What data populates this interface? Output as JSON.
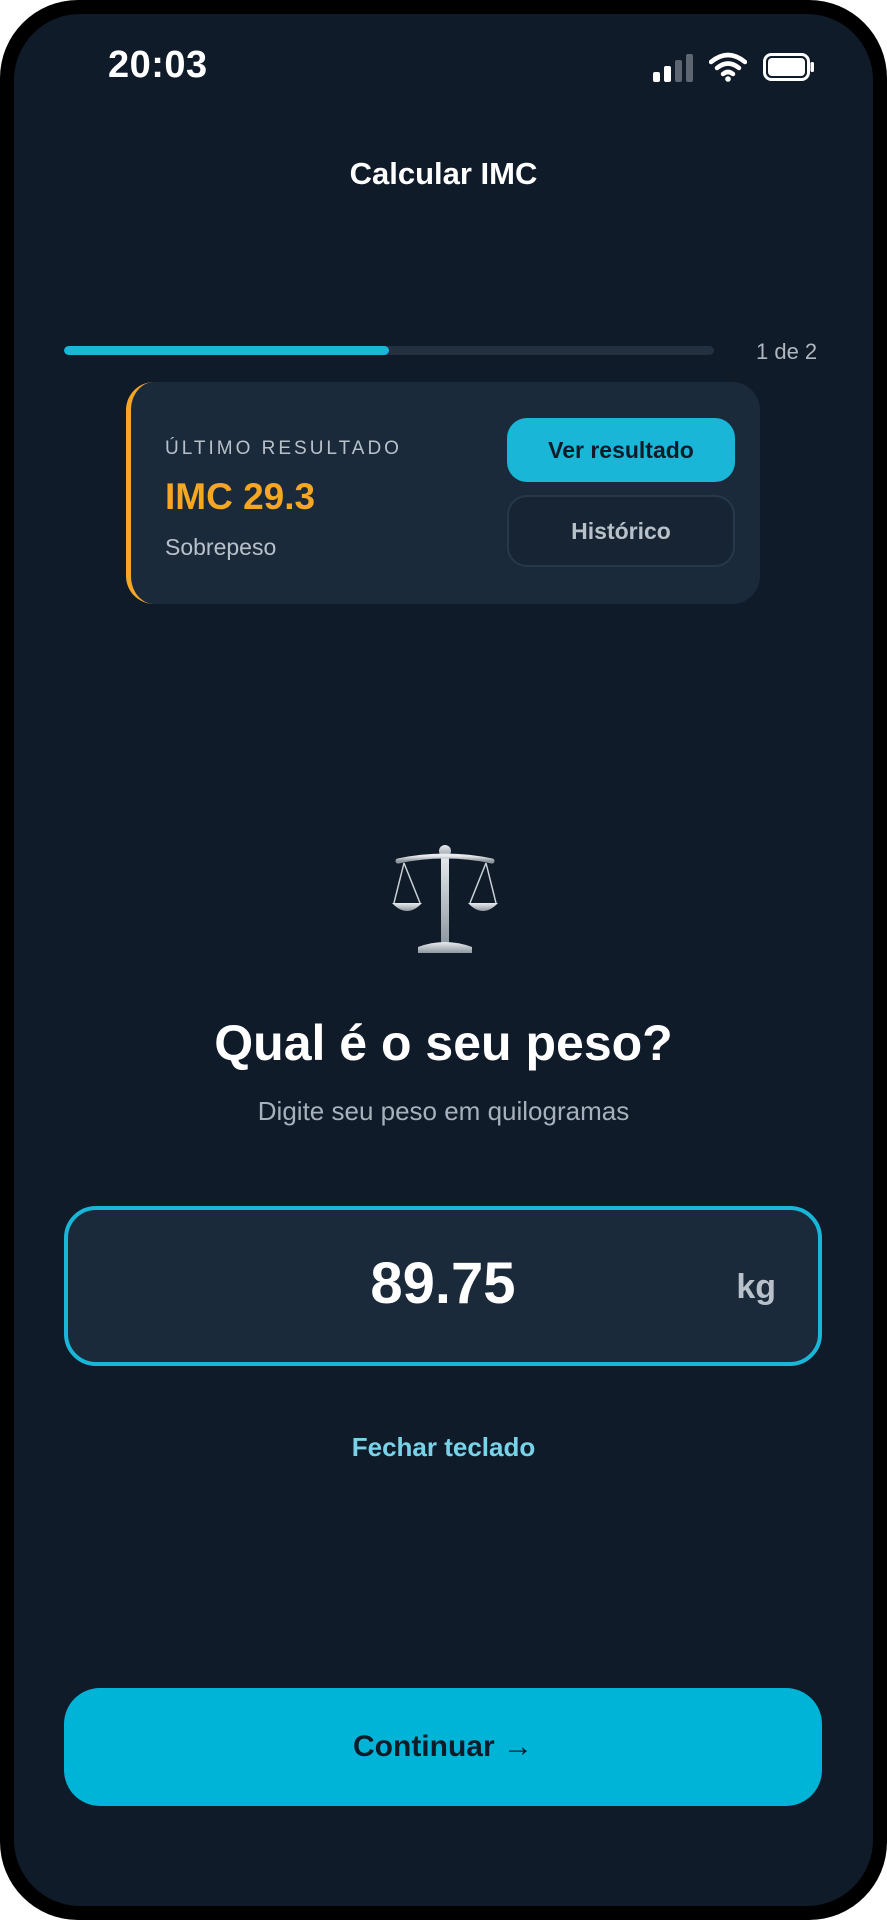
{
  "status_bar": {
    "time": "20:03"
  },
  "header": {
    "title": "Calcular IMC"
  },
  "progress": {
    "label": "1 de 2",
    "fraction": 0.5
  },
  "last_result": {
    "overline": "ÚLTIMO RESULTADO",
    "value": "IMC 29.3",
    "category": "Sobrepeso",
    "view_button": "Ver resultado",
    "history_button": "Histórico",
    "accent_color": "#f5a623"
  },
  "question": {
    "icon": "balance-scale-icon",
    "title": "Qual é o seu peso?",
    "subtitle": "Digite seu peso em quilogramas"
  },
  "weight_input": {
    "value": "89.75",
    "unit": "kg"
  },
  "close_keyboard_label": "Fechar teclado",
  "continue_label": "Continuar →",
  "colors": {
    "background": "#0f1b29",
    "accent": "#19b6d8",
    "card": "#1b2a3a",
    "warning": "#f5a623"
  }
}
